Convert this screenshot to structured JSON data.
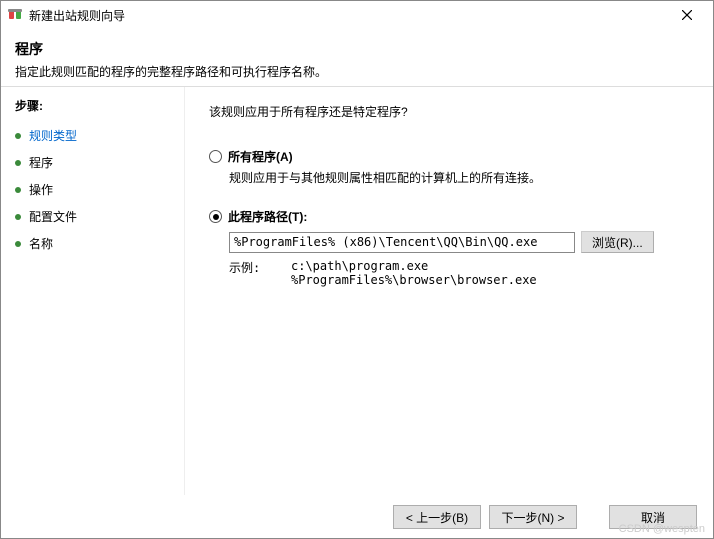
{
  "titlebar": {
    "title": "新建出站规则向导"
  },
  "header": {
    "title": "程序",
    "description": "指定此规则匹配的程序的完整程序路径和可执行程序名称。"
  },
  "sidebar": {
    "heading": "步骤:",
    "steps": [
      {
        "label": "规则类型",
        "link": true
      },
      {
        "label": "程序",
        "link": false
      },
      {
        "label": "操作",
        "link": false
      },
      {
        "label": "配置文件",
        "link": false
      },
      {
        "label": "名称",
        "link": false
      }
    ]
  },
  "content": {
    "question": "该规则应用于所有程序还是特定程序?",
    "option1": {
      "label": "所有程序(A)",
      "desc": "规则应用于与其他规则属性相匹配的计算机上的所有连接。"
    },
    "option2": {
      "label": "此程序路径(T):",
      "path_value": "%ProgramFiles% (x86)\\Tencent\\QQ\\Bin\\QQ.exe",
      "browse_label": "浏览(R)..."
    },
    "example": {
      "label": "示例:",
      "line1": "c:\\path\\program.exe",
      "line2": "%ProgramFiles%\\browser\\browser.exe"
    }
  },
  "footer": {
    "back": "< 上一步(B)",
    "next": "下一步(N) >",
    "cancel": "取消"
  },
  "watermark": "CSDN @wespten"
}
